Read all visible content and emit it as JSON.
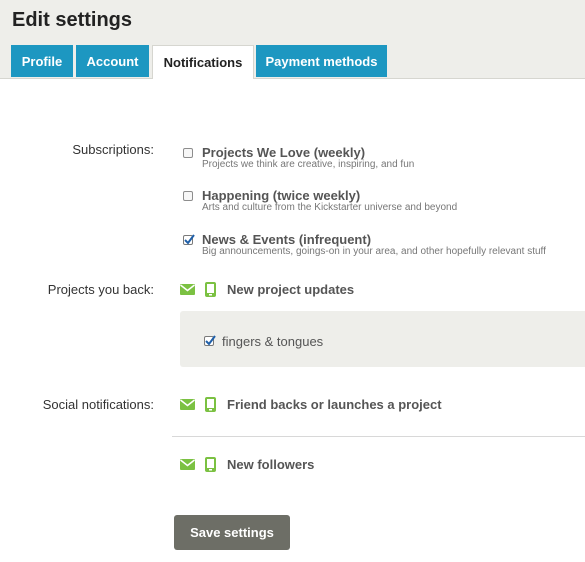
{
  "page": {
    "title": "Edit settings"
  },
  "tabs": [
    {
      "label": "Profile",
      "active": false
    },
    {
      "label": "Account",
      "active": false
    },
    {
      "label": "Notifications",
      "active": true
    },
    {
      "label": "Payment methods",
      "active": false
    }
  ],
  "subscriptions": {
    "label": "Subscriptions:",
    "items": [
      {
        "title": "Projects We Love (weekly)",
        "description": "Projects we think are creative, inspiring, and fun",
        "checked": false
      },
      {
        "title": "Happening (twice weekly)",
        "description": "Arts and culture from the Kickstarter universe and beyond",
        "checked": false
      },
      {
        "title": "News & Events (infrequent)",
        "description": "Big announcements, goings-on in your area, and other hopefully relevant stuff",
        "checked": true
      }
    ]
  },
  "projects_you_back": {
    "label": "Projects you back:",
    "notification": {
      "text": "New project updates",
      "email_icon": "mail-icon",
      "mobile_icon": "phone-icon"
    },
    "backed_projects": [
      {
        "name": "fingers & tongues",
        "checked": true
      }
    ]
  },
  "social_notifications": {
    "label": "Social notifications:",
    "items": [
      {
        "text": "Friend backs or launches a project",
        "email_icon": "mail-icon",
        "mobile_icon": "phone-icon"
      },
      {
        "text": "New followers",
        "email_icon": "mail-icon",
        "mobile_icon": "phone-icon"
      }
    ]
  },
  "actions": {
    "save_label": "Save settings"
  },
  "colors": {
    "tab_blue": "#1d97c1",
    "icon_green": "#7bc142",
    "button_gray": "#6d6e66",
    "header_bg": "#eeeeea"
  }
}
